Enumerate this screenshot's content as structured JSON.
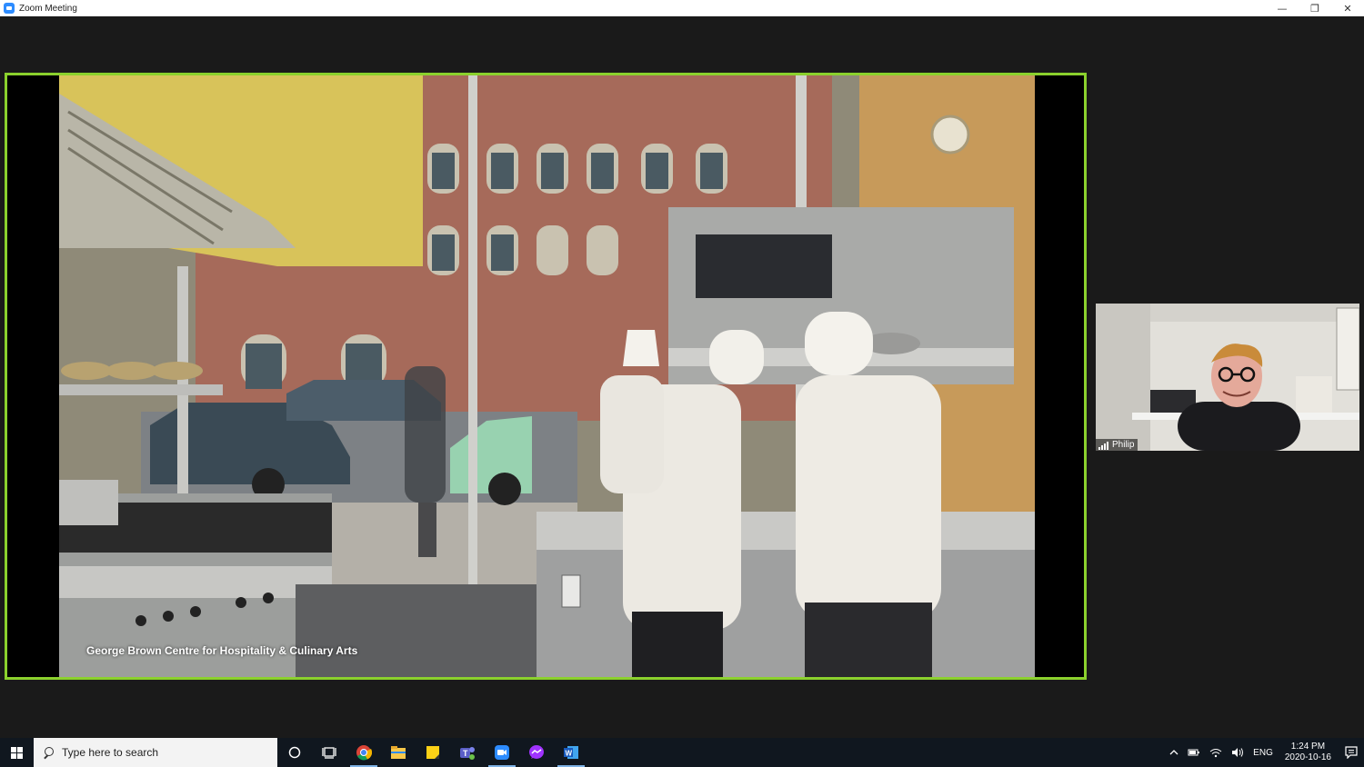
{
  "window": {
    "title": "Zoom Meeting",
    "minimize_glyph": "—",
    "restore_glyph": "❐",
    "close_glyph": "✕"
  },
  "share": {
    "caption": "George Brown Centre for Hospitality & Culinary Arts",
    "border_color": "#8bd12d"
  },
  "participant": {
    "name": "Philip"
  },
  "taskbar": {
    "search_placeholder": "Type here to search",
    "pinned": [
      "cortana-icon",
      "task-view-icon",
      "chrome-icon",
      "file-explorer-icon",
      "sticky-notes-icon",
      "teams-icon",
      "zoom-icon",
      "messenger-icon",
      "word-icon"
    ],
    "tray": {
      "language": "ENG",
      "time": "1:24 PM",
      "date": "2020-10-16"
    }
  }
}
